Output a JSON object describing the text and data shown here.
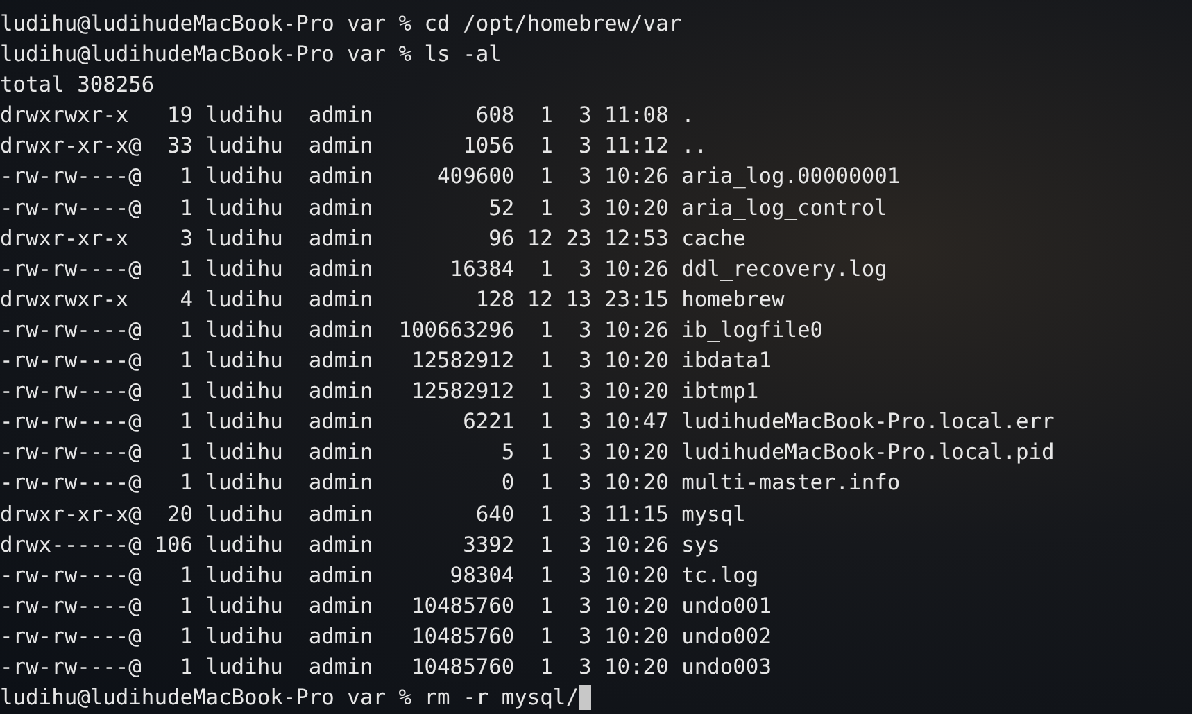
{
  "terminal": {
    "lines": [
      {
        "kind": "prompt",
        "prompt": "ludihu@ludihudeMacBook-Pro var %",
        "command": "cd /opt/homebrew/var"
      },
      {
        "kind": "prompt",
        "prompt": "ludihu@ludihudeMacBook-Pro var %",
        "command": "ls -al"
      },
      {
        "kind": "output",
        "text": "total 308256"
      },
      {
        "kind": "output",
        "text": "drwxrwxr-x   19 ludihu  admin        608  1  3 11:08 ."
      },
      {
        "kind": "output",
        "text": "drwxr-xr-x@  33 ludihu  admin       1056  1  3 11:12 .."
      },
      {
        "kind": "output",
        "text": "-rw-rw----@   1 ludihu  admin     409600  1  3 10:26 aria_log.00000001"
      },
      {
        "kind": "output",
        "text": "-rw-rw----@   1 ludihu  admin         52  1  3 10:20 aria_log_control"
      },
      {
        "kind": "output",
        "text": "drwxr-xr-x    3 ludihu  admin         96 12 23 12:53 cache"
      },
      {
        "kind": "output",
        "text": "-rw-rw----@   1 ludihu  admin      16384  1  3 10:26 ddl_recovery.log"
      },
      {
        "kind": "output",
        "text": "drwxrwxr-x    4 ludihu  admin        128 12 13 23:15 homebrew"
      },
      {
        "kind": "output",
        "text": "-rw-rw----@   1 ludihu  admin  100663296  1  3 10:26 ib_logfile0"
      },
      {
        "kind": "output",
        "text": "-rw-rw----@   1 ludihu  admin   12582912  1  3 10:20 ibdata1"
      },
      {
        "kind": "output",
        "text": "-rw-rw----@   1 ludihu  admin   12582912  1  3 10:20 ibtmp1"
      },
      {
        "kind": "output",
        "text": "-rw-rw----@   1 ludihu  admin       6221  1  3 10:47 ludihudeMacBook-Pro.local.err"
      },
      {
        "kind": "output",
        "text": "-rw-rw----@   1 ludihu  admin          5  1  3 10:20 ludihudeMacBook-Pro.local.pid"
      },
      {
        "kind": "output",
        "text": "-rw-rw----@   1 ludihu  admin          0  1  3 10:20 multi-master.info"
      },
      {
        "kind": "output",
        "text": "drwxr-xr-x@  20 ludihu  admin        640  1  3 11:15 mysql"
      },
      {
        "kind": "output",
        "text": "drwx------@ 106 ludihu  admin       3392  1  3 10:26 sys"
      },
      {
        "kind": "output",
        "text": "-rw-rw----@   1 ludihu  admin      98304  1  3 10:20 tc.log"
      },
      {
        "kind": "output",
        "text": "-rw-rw----@   1 ludihu  admin   10485760  1  3 10:20 undo001"
      },
      {
        "kind": "output",
        "text": "-rw-rw----@   1 ludihu  admin   10485760  1  3 10:20 undo002"
      },
      {
        "kind": "output",
        "text": "-rw-rw----@   1 ludihu  admin   10485760  1  3 10:20 undo003"
      },
      {
        "kind": "input",
        "prompt": "ludihu@ludihudeMacBook-Pro var %",
        "command": "rm -r mysql/"
      }
    ]
  }
}
